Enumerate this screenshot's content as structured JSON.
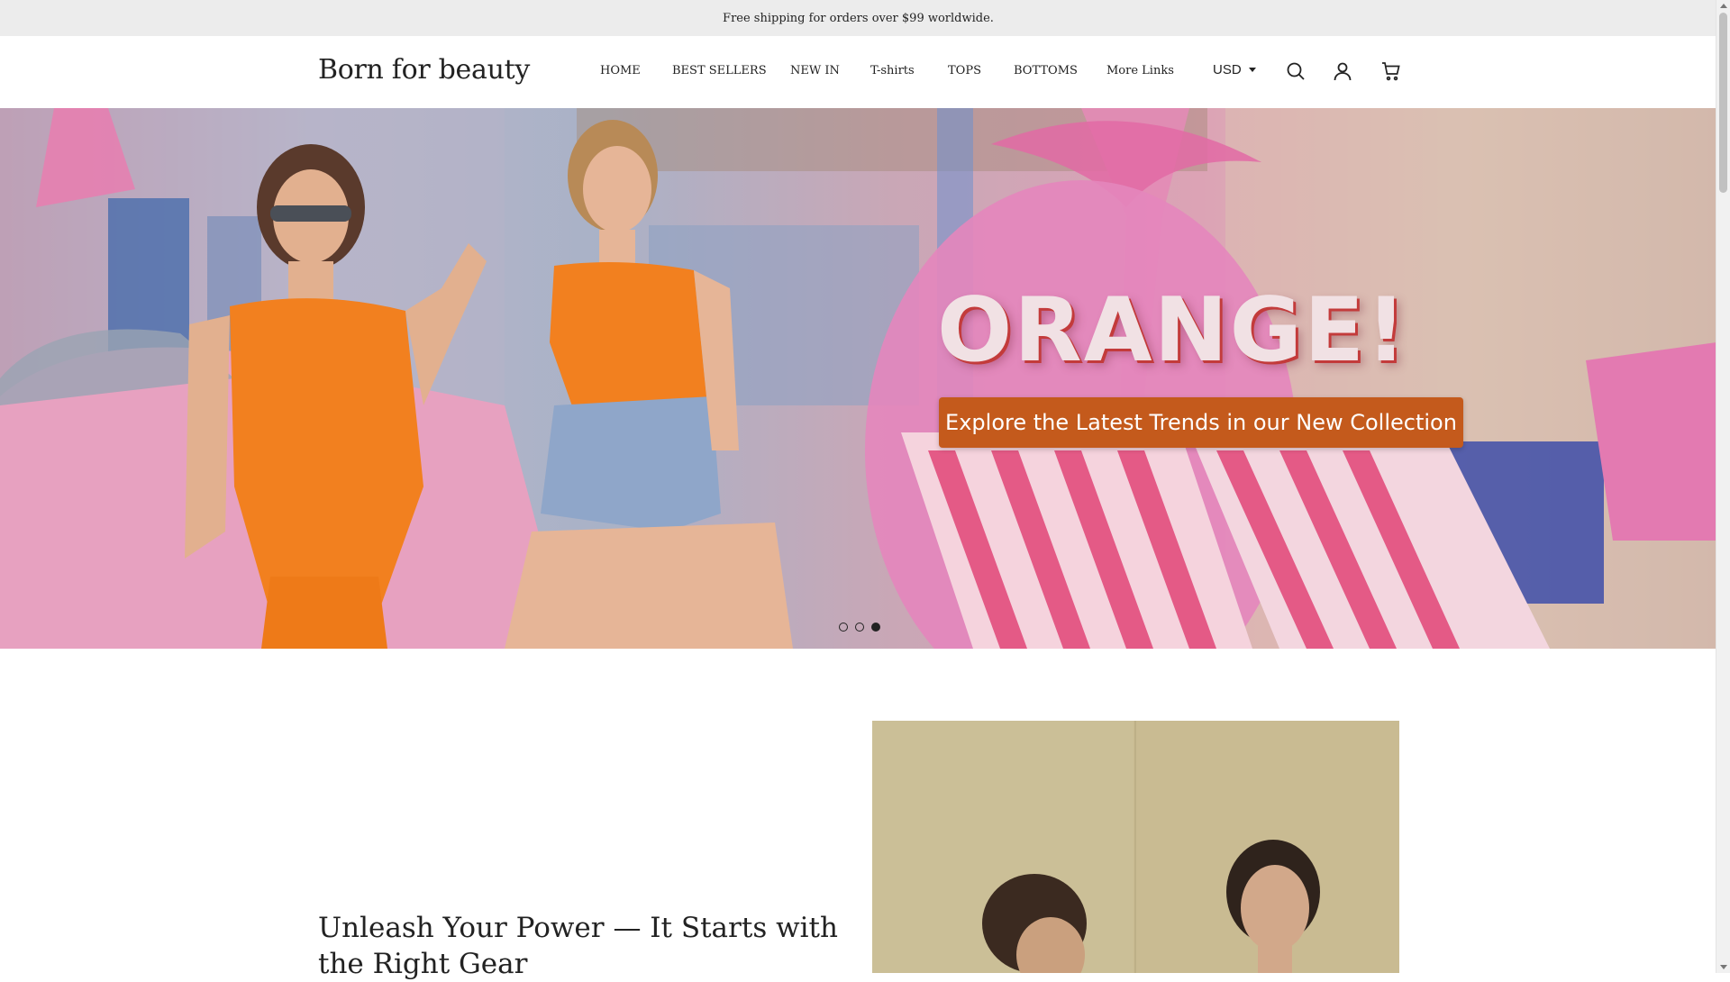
{
  "announcement": {
    "text": "Free shipping for orders over $99 worldwide."
  },
  "header": {
    "logo": "Born for beauty",
    "nav": [
      "HOME",
      "BEST SELLERS",
      "NEW IN",
      "T-shirts",
      "TOPS",
      "BOTTOMS",
      "More Links"
    ],
    "currency": "USD",
    "icons": [
      "search-icon",
      "account-icon",
      "cart-icon"
    ]
  },
  "hero": {
    "headline": "ORANGE!",
    "cta_label": "Explore the Latest Trends in our New Collection",
    "slides_total": 3,
    "active_slide": 3,
    "colors": {
      "cta": "#c45a1c",
      "headline_shadow": "#c33b3b",
      "outfit": "#f2801f"
    }
  },
  "feature": {
    "title": "Unleash Your Power — It Starts with the Right Gear"
  }
}
